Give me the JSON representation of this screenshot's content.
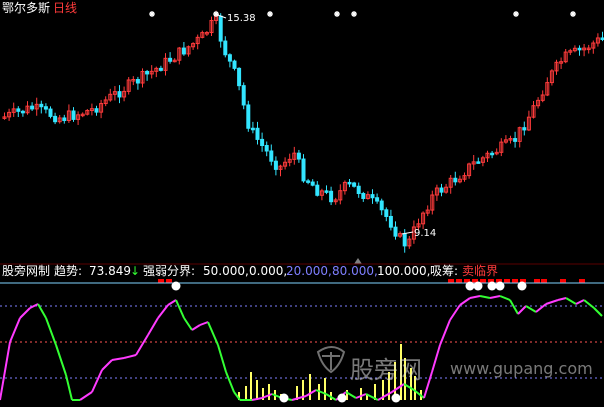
{
  "top_panel": {
    "stock_name": "鄂尔多斯",
    "period": "日线",
    "high_label": "15.38",
    "low_label": "9.14"
  },
  "indicator_panel": {
    "name": "股旁网制",
    "trend_label": "趋势:",
    "trend_value": "73.849",
    "trend_arrow": "↓",
    "boundary_label": "强弱分界:",
    "levels": [
      "50.000,",
      "0.000,",
      "20.000,",
      "80.000,",
      "100.000,"
    ],
    "absorb_label": "吸筹:",
    "sell_label": "卖临界"
  },
  "watermark": {
    "cn": "股旁网",
    "url": "www.gupang.com"
  },
  "colors": {
    "up": "#ff3b3b",
    "down": "#33e5ff",
    "trend_up": "#ff3bff",
    "trend_down": "#33ff33",
    "volume": "#ffff66",
    "level_20": "#7f7fff",
    "level_80": "#7f7fff",
    "sell_marker": "#ff0000",
    "star": "#ffffff"
  },
  "chart_data": {
    "type": "candlestick",
    "price_extremes": {
      "high": 15.38,
      "low": 9.14
    },
    "trend_current": 73.849,
    "levels": [
      50,
      0,
      20,
      80,
      100
    ]
  }
}
